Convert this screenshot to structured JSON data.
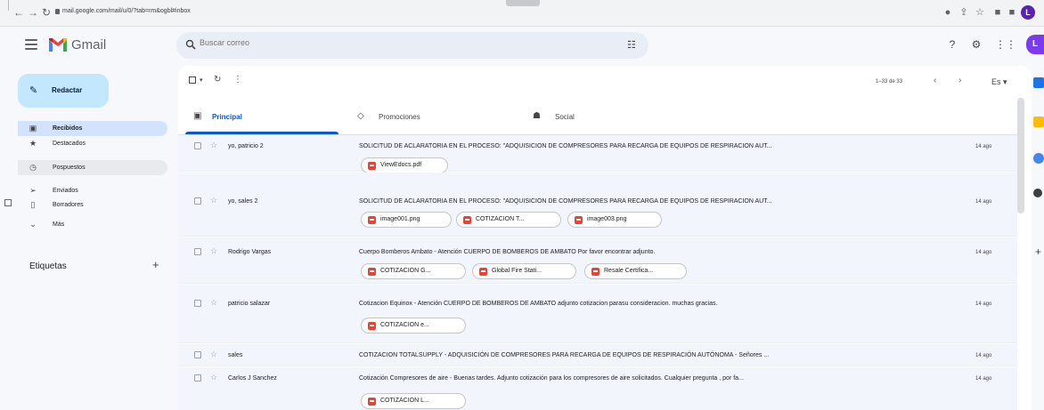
{
  "browser": {
    "url": "mail.google.com/mail/u/0/?tab=rm&ogbl#inbox",
    "profile_initial": "L"
  },
  "header": {
    "app_name": "Gmail",
    "search_placeholder": "Buscar correo",
    "account_initial": "L"
  },
  "sidebar": {
    "compose_label": "Redactar",
    "items": [
      {
        "label": "Recibidos",
        "icon": "inbox-icon"
      },
      {
        "label": "Destacados",
        "icon": "star-icon"
      },
      {
        "label": "Pospuestos",
        "icon": "clock-icon"
      },
      {
        "label": "Enviados",
        "icon": "send-icon"
      },
      {
        "label": "Borradores",
        "icon": "draft-icon"
      },
      {
        "label": "Más",
        "icon": "chevron-down-icon"
      }
    ],
    "labels_title": "Etiquetas"
  },
  "toolbar": {
    "pagination": "1–33 de 33",
    "language": "Es"
  },
  "tabs": [
    {
      "label": "Principal",
      "icon": "inbox-icon"
    },
    {
      "label": "Promociones",
      "icon": "tag-icon"
    },
    {
      "label": "Social",
      "icon": "people-icon"
    }
  ],
  "emails": [
    {
      "sender": "yo, patricio 2",
      "subject": "SOLICITUD DE ACLARATORIA EN EL PROCESO: \"ADQUISICION DE COMPRESORES PARA RECARGA DE EQUIPOS DE RESPIRACION AUT...",
      "date": "14 ago",
      "attachments": [
        "ViewEdocs.pdf"
      ]
    },
    {
      "sender": "yo, sales 2",
      "subject": "SOLICITUD DE ACLARATORIA EN EL PROCESO: \"ADQUISICION DE COMPRESORES PARA RECARGA DE EQUIPOS DE RESPIRACION AUT...",
      "date": "14 ago",
      "attachments": [
        "image001.png",
        "COTIZACION T...",
        "image003.png"
      ]
    },
    {
      "sender": "Rodrigo Vargas",
      "subject": "Cuerpo Bomberos Ambato - Atención CUERPO DE BOMBEROS DE AMBATO Por favor encontrar adjunto.",
      "date": "14 ago",
      "attachments": [
        "COTIZACION G...",
        "Global Fire Stati...",
        "Resale Certifica..."
      ]
    },
    {
      "sender": "patricio salazar",
      "subject": "Cotizacion Equinox - Atención CUERPO DE BOMBEROS DE AMBATO adjunto cotizacion parasu consideracion. muchas gracias.",
      "date": "14 ago",
      "attachments": [
        "COTIZACION e..."
      ]
    },
    {
      "sender": "sales",
      "subject": "COTIZACION TOTALSUPPLY - ADQUISICIÓN DE COMPRESORES PARA RECARGA DE EQUIPOS DE RESPIRACIÓN AUTÓNOMA - Señores ...",
      "date": "14 ago",
      "attachments": []
    },
    {
      "sender": "Carlos J Sanchez",
      "subject": "Cotización Compresores de aire - Buenas tardes. Adjunto cotización para los compresores de aire solicitados. Cualquier pregunta , por fa...",
      "date": "14 ago",
      "attachments": [
        "COTIZACION L..."
      ]
    }
  ],
  "colors": {
    "accent": "#0b57d0",
    "compose_bg": "#c2e7ff",
    "active_nav": "#d3e3fd",
    "attachment_icon": "#ea4335"
  }
}
